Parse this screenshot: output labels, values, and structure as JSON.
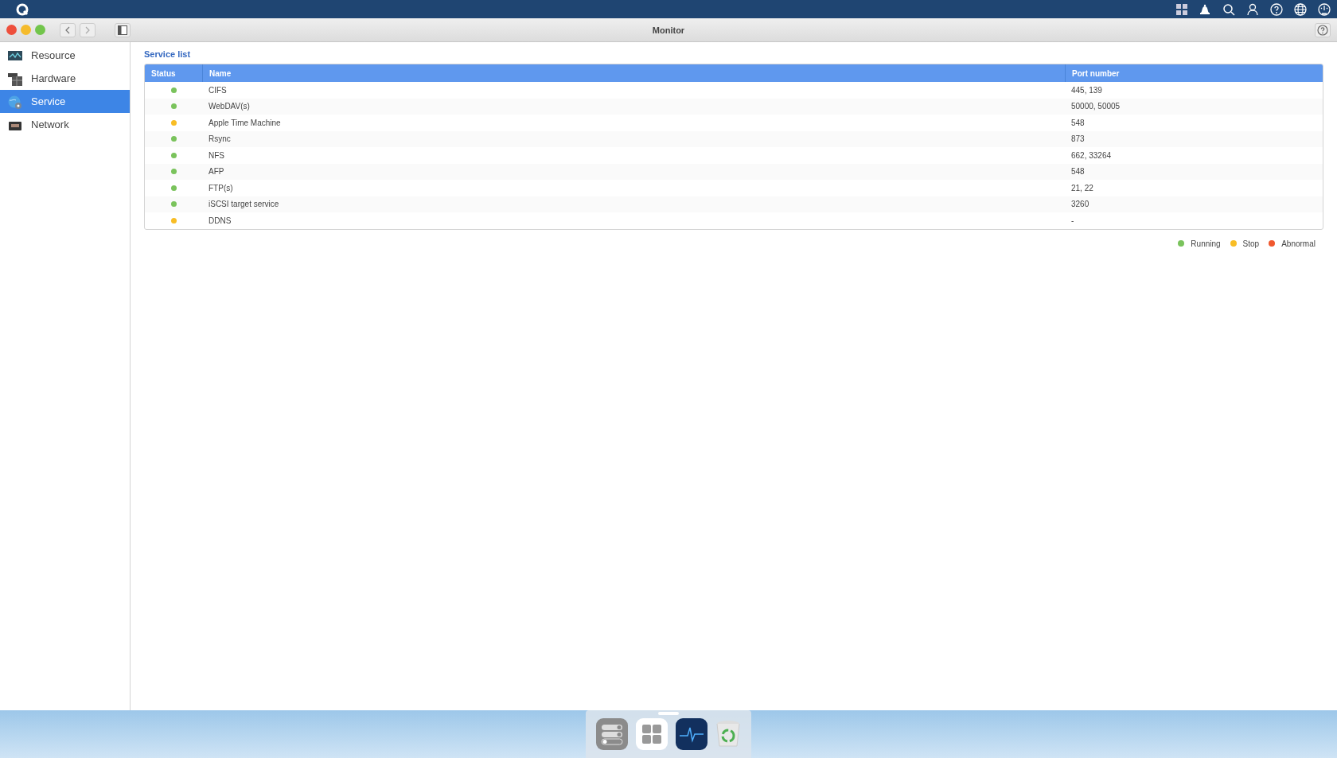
{
  "window": {
    "title": "Monitor"
  },
  "sidebar": {
    "items": [
      {
        "label": "Resource",
        "selected": false,
        "kind": "resource"
      },
      {
        "label": "Hardware",
        "selected": false,
        "kind": "hardware"
      },
      {
        "label": "Service",
        "selected": true,
        "kind": "service"
      },
      {
        "label": "Network",
        "selected": false,
        "kind": "network"
      }
    ]
  },
  "section_title": "Service list",
  "table": {
    "columns": [
      "Status",
      "Name",
      "Port number"
    ],
    "rows": [
      {
        "color": "#7ac35c",
        "name": "CIFS",
        "port": "445, 139"
      },
      {
        "color": "#7ac35c",
        "name": "WebDAV(s)",
        "port": "50000, 50005"
      },
      {
        "color": "#f8bd25",
        "name": "Apple Time Machine",
        "port": "548"
      },
      {
        "color": "#7ac35c",
        "name": "Rsync",
        "port": "873"
      },
      {
        "color": "#7ac35c",
        "name": "NFS",
        "port": "662, 33264"
      },
      {
        "color": "#7ac35c",
        "name": "AFP",
        "port": "548"
      },
      {
        "color": "#7ac35c",
        "name": "FTP(s)",
        "port": "21, 22"
      },
      {
        "color": "#7ac35c",
        "name": "iSCSI target service",
        "port": "3260"
      },
      {
        "color": "#f8bd25",
        "name": "DDNS",
        "port": "-"
      }
    ]
  },
  "legend": [
    {
      "label": "Running",
      "color": "#7ac35c"
    },
    {
      "label": "Stop",
      "color": "#f8bd25"
    },
    {
      "label": "Abnormal",
      "color": "#f0582e"
    }
  ]
}
